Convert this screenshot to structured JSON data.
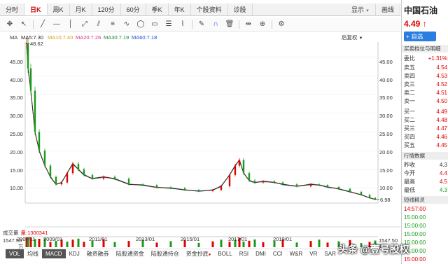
{
  "tabs": [
    {
      "label": "分时"
    },
    {
      "label": "日K"
    },
    {
      "label": "周K"
    },
    {
      "label": "月K"
    },
    {
      "label": "120分"
    },
    {
      "label": "60分"
    },
    {
      "label": "季K"
    },
    {
      "label": "年K"
    },
    {
      "label": "个股资料"
    },
    {
      "label": "诊股"
    }
  ],
  "display_label": "显示",
  "draw_label": "画线",
  "indicator": "MA",
  "ma": {
    "ma5": "MA5:7.30",
    "ma10": "MA10:7.40",
    "ma20": "MA20:7.26",
    "ma30": "MA30:7.19",
    "ma60": "MA60:7.18"
  },
  "fuquan": "后复权",
  "high_label": "48.62",
  "low_label": "6.98",
  "y_ticks": [
    "45.00",
    "40.00",
    "35.00",
    "30.00",
    "25.00",
    "20.00",
    "15.00",
    "10.00"
  ],
  "x_dates": [
    "2007/11",
    "2009/01",
    "2011/01",
    "2013/01",
    "2015/01",
    "2017/01",
    "2019/01"
  ],
  "volume": {
    "title": "成交量",
    "ma_label": "量:1300341",
    "max_left": "1547.50",
    "max_right": "1547.50",
    "unit": "万"
  },
  "bottom_tabs": [
    "VOL",
    "均线",
    "MACD",
    "KDJ",
    "融资融券",
    "陆股通资金",
    "陆股通持仓",
    "资金抄底",
    "BOLL",
    "RSI",
    "DMI",
    "CCI",
    "W&R",
    "VR",
    "SAR"
  ],
  "colors": {
    "up": "#e00000",
    "down": "#1a9a1a",
    "ma5": "#222222",
    "ma10": "#d4a017",
    "ma20": "#d63384",
    "ma30": "#1f8a3a",
    "ma60": "#1f4fd6"
  },
  "right": {
    "name": "中国石油",
    "price": "4.49",
    "arrow": "↑",
    "add_label": "+ 自选",
    "bidask_title": "买卖档位与明细",
    "wb_label": "委比",
    "wb_value": "+1.31%",
    "asks": [
      {
        "label": "卖五",
        "p": "4.54"
      },
      {
        "label": "卖四",
        "p": "4.53"
      },
      {
        "label": "卖三",
        "p": "4.52"
      },
      {
        "label": "卖二",
        "p": "4.51"
      },
      {
        "label": "卖一",
        "p": "4.50"
      }
    ],
    "bids": [
      {
        "label": "买一",
        "p": "4.49"
      },
      {
        "label": "买二",
        "p": "4.48"
      },
      {
        "label": "买三",
        "p": "4.47"
      },
      {
        "label": "买四",
        "p": "4.46"
      },
      {
        "label": "买五",
        "p": "4.45"
      }
    ],
    "quote_title": "行情数据",
    "quotes": [
      {
        "label": "昨收",
        "v": "4.3"
      },
      {
        "label": "今开",
        "v": "4.4"
      },
      {
        "label": "最高",
        "v": "4.5"
      },
      {
        "label": "最低",
        "v": "4.3"
      }
    ],
    "elf_title": "短线精灵",
    "ticks": [
      {
        "t": "14:57:00"
      },
      {
        "t": "15:00:00"
      },
      {
        "t": "15:00:00"
      },
      {
        "t": "15:00:00"
      },
      {
        "t": "15:00:00"
      },
      {
        "t": "15:00:00"
      },
      {
        "t": "15:00:00"
      }
    ]
  },
  "watermark": "头条 @壹号股权",
  "chart_data": {
    "type": "candlestick",
    "title": "",
    "ylim": [
      6.0,
      49.0
    ],
    "y_ticks": [
      45,
      40,
      35,
      30,
      25,
      20,
      15,
      10
    ],
    "x_ticks": [
      "2007/11",
      "2009/01",
      "2011/01",
      "2013/01",
      "2015/01",
      "2017/01",
      "2019/01"
    ],
    "series": [
      {
        "name": "MA5",
        "last": 7.3
      },
      {
        "name": "MA10",
        "last": 7.4
      },
      {
        "name": "MA20",
        "last": 7.26
      },
      {
        "name": "MA30",
        "last": 7.19
      },
      {
        "name": "MA60",
        "last": 7.18
      }
    ],
    "x": [
      2007.85,
      2007.9,
      2008.0,
      2008.15,
      2008.3,
      2008.5,
      2008.7,
      2008.9,
      2009.1,
      2009.3,
      2009.5,
      2009.7,
      2009.9,
      2010.2,
      2010.6,
      2011.0,
      2011.5,
      2012.0,
      2012.5,
      2013.0,
      2013.5,
      2014.0,
      2014.5,
      2014.8,
      2015.1,
      2015.3,
      2015.45,
      2015.6,
      2015.8,
      2016.0,
      2016.3,
      2016.7,
      2017.0,
      2017.5,
      2018.0,
      2018.3,
      2018.6,
      2019.0,
      2019.4,
      2019.8,
      2020.1,
      2020.3
    ],
    "close": [
      48.62,
      42.0,
      36.0,
      25.0,
      20.0,
      16.0,
      13.0,
      11.0,
      11.5,
      14.0,
      16.5,
      15.0,
      13.5,
      12.5,
      13.0,
      12.5,
      11.0,
      10.8,
      10.2,
      10.0,
      9.5,
      9.2,
      9.5,
      10.5,
      13.5,
      16.0,
      17.5,
      14.0,
      12.0,
      11.5,
      11.8,
      11.5,
      11.0,
      10.5,
      11.0,
      10.8,
      10.3,
      9.8,
      9.0,
      8.2,
      7.4,
      6.98
    ],
    "annotations": [
      {
        "text": "48.62",
        "type": "high"
      },
      {
        "text": "6.98",
        "type": "low"
      }
    ],
    "volume_max": 1547.5
  }
}
